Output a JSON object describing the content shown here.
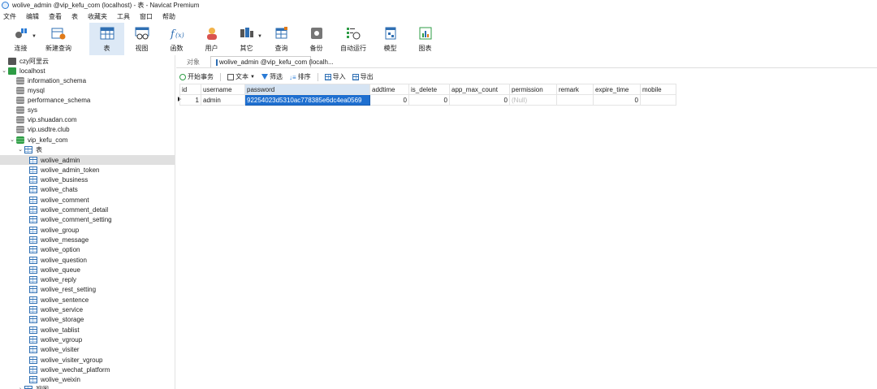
{
  "window": {
    "title": "wolive_admin @vip_kefu_com (localhost) - 表 - Navicat Premium"
  },
  "menu": [
    "文件",
    "编辑",
    "查看",
    "表",
    "收藏夹",
    "工具",
    "窗口",
    "帮助"
  ],
  "toolbar": [
    {
      "label": "连接",
      "icon": "plug-icon"
    },
    {
      "label": "新建查询",
      "icon": "new-query-icon"
    },
    {
      "label": "表",
      "icon": "table-icon"
    },
    {
      "label": "视图",
      "icon": "view-icon"
    },
    {
      "label": "函数",
      "icon": "function-icon"
    },
    {
      "label": "用户",
      "icon": "user-icon"
    },
    {
      "label": "其它",
      "icon": "other-icon"
    },
    {
      "label": "查询",
      "icon": "query-icon"
    },
    {
      "label": "备份",
      "icon": "backup-icon"
    },
    {
      "label": "自动运行",
      "icon": "schedule-icon"
    },
    {
      "label": "模型",
      "icon": "model-icon"
    },
    {
      "label": "图表",
      "icon": "chart-icon"
    }
  ],
  "tree": {
    "connections": [
      {
        "label": "czy阿里云"
      },
      {
        "label": "localhost"
      }
    ],
    "databases": [
      "information_schema",
      "mysql",
      "performance_schema",
      "sys",
      "vip.shuadan.com",
      "vip.usdtre.club",
      "vip_kefu_com"
    ],
    "tables_folder": "表",
    "tables": [
      "wolive_admin",
      "wolive_admin_token",
      "wolive_business",
      "wolive_chats",
      "wolive_comment",
      "wolive_comment_detail",
      "wolive_comment_setting",
      "wolive_group",
      "wolive_message",
      "wolive_option",
      "wolive_question",
      "wolive_queue",
      "wolive_reply",
      "wolive_rest_setting",
      "wolive_sentence",
      "wolive_service",
      "wolive_storage",
      "wolive_tablist",
      "wolive_vgroup",
      "wolive_visiter",
      "wolive_visiter_vgroup",
      "wolive_wechat_platform",
      "wolive_weixin"
    ],
    "views_folder": "视图"
  },
  "tabs": {
    "objects": "对象",
    "active": "wolive_admin @vip_kefu_com (localh..."
  },
  "subtoolbar": {
    "begin": "开始事务",
    "text": "文本",
    "filter": "筛选",
    "sort": "排序",
    "import": "导入",
    "export": "导出"
  },
  "grid": {
    "columns": [
      "id",
      "username",
      "password",
      "addtime",
      "is_delete",
      "app_max_count",
      "permission",
      "remark",
      "expire_time",
      "mobile"
    ],
    "row": {
      "id": "1",
      "username": "admin",
      "password": "92254023d5310ac778385e6dc4ea0569",
      "addtime": "0",
      "is_delete": "0",
      "app_max_count": "0",
      "permission": "(Null)",
      "remark": "",
      "expire_time": "0",
      "mobile": ""
    }
  }
}
